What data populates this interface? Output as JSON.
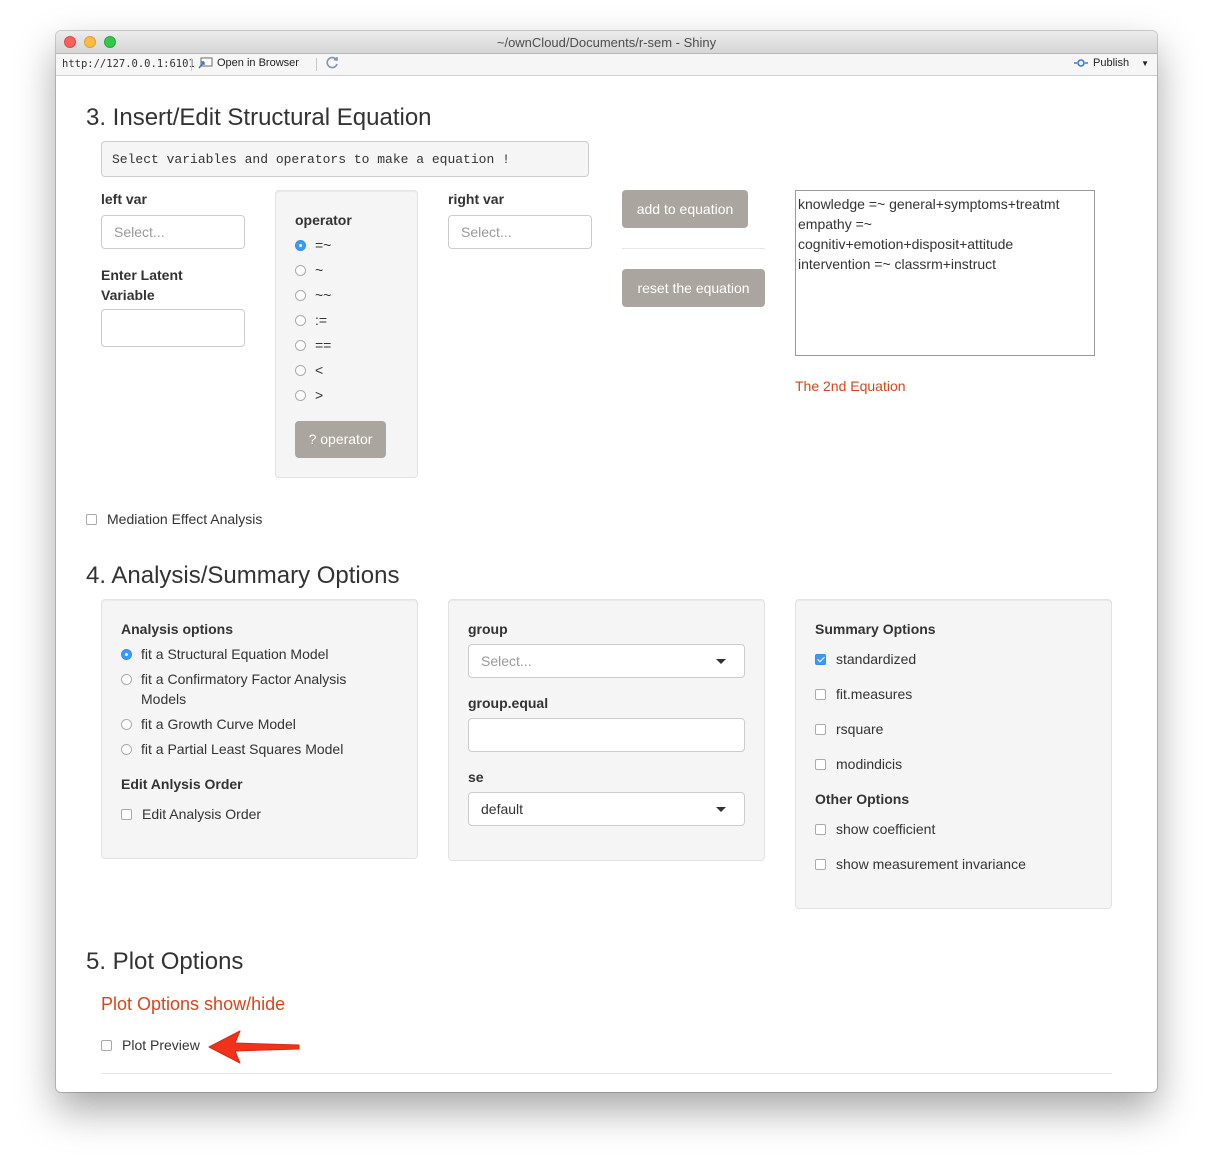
{
  "window": {
    "title": "~/ownCloud/Documents/r-sem - Shiny"
  },
  "toolbar": {
    "url": "http://127.0.0.1:6101",
    "open_browser": "Open in Browser",
    "publish": "Publish"
  },
  "section3": {
    "heading": "3. Insert/Edit Structural Equation",
    "hint": "Select variables and operators to make a equation !",
    "left_var_label": "left var",
    "left_var_placeholder": "Select...",
    "latent_label_line1": "Enter Latent",
    "latent_label_line2": "Variable",
    "operator_label": "operator",
    "operators": [
      "=~",
      "~",
      "~~",
      ":=",
      "==",
      "<",
      ">"
    ],
    "operator_selected": "=~",
    "operator_help_button": "? operator",
    "right_var_label": "right var",
    "right_var_placeholder": "Select...",
    "add_button": "add to equation",
    "reset_button": "reset the equation",
    "equation_lines": [
      "knowledge =~ general+symptoms+treatmt",
      "empathy =~",
      "cognitiv+emotion+disposit+attitude",
      "intervention =~ classrm+instruct"
    ],
    "second_equation_link": "The 2nd Equation",
    "mediation_label": "Mediation Effect Analysis"
  },
  "section4": {
    "heading": "4. Analysis/Summary Options",
    "analysis_title": "Analysis options",
    "analysis_options": [
      "fit a Structural Equation Model",
      "fit a Confirmatory Factor Analysis",
      "Models",
      "fit a Growth Curve Model",
      "fit a Partial Least Squares Model"
    ],
    "analysis_selected": "fit a Structural Equation Model",
    "edit_order_title": "Edit Anlysis Order",
    "edit_order_label": "Edit Analysis Order",
    "group_label": "group",
    "group_placeholder": "Select...",
    "group_equal_label": "group.equal",
    "se_label": "se",
    "se_value": "default",
    "summary_title": "Summary Options",
    "summary_options": [
      "standardized",
      "fit.measures",
      "rsquare",
      "modindicis"
    ],
    "summary_checked": [
      "standardized"
    ],
    "other_title": "Other Options",
    "other_options": [
      "show coefficient",
      "show measurement invariance"
    ]
  },
  "section5": {
    "heading": "5. Plot Options",
    "toggle_link": "Plot Options show/hide",
    "plot_preview_label": "Plot Preview"
  },
  "colors": {
    "accent_orange": "#d9451b",
    "button_gray": "#aaa59f",
    "radio_blue": "#3b99fc",
    "arrow_red": "#f0321a"
  }
}
